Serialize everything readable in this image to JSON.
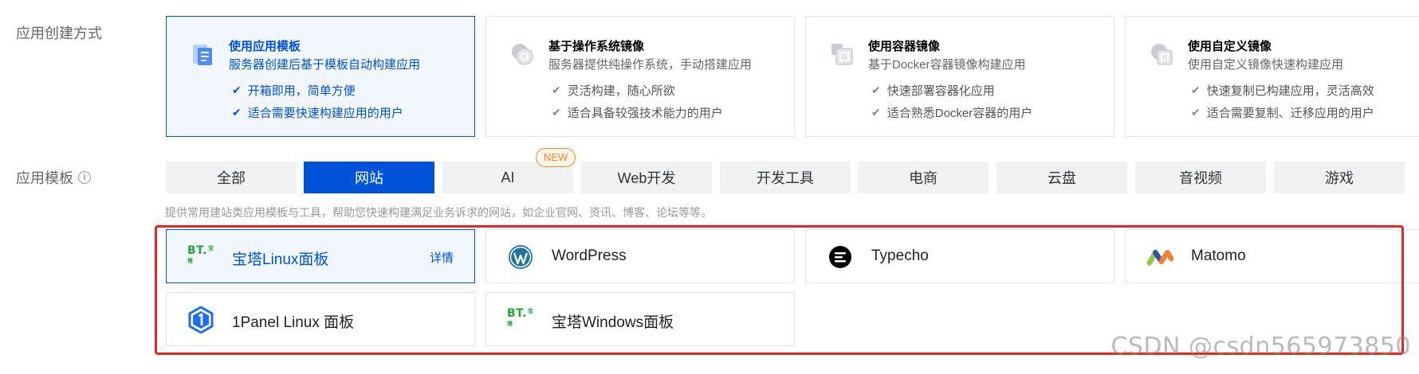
{
  "labels": {
    "create_method": "应用创建方式",
    "app_template": "应用模板"
  },
  "methods": [
    {
      "title": "使用应用模板",
      "desc": "服务器创建后基于模板自动构建应用",
      "features": [
        "开箱即用，简单方便",
        "适合需要快速构建应用的用户"
      ],
      "selected": true,
      "icon": "template-icon"
    },
    {
      "title": "基于操作系统镜像",
      "desc": "服务器提供纯操作系统，手动搭建应用",
      "features": [
        "灵活构建，随心所欲",
        "适合具备较强技术能力的用户"
      ],
      "selected": false,
      "icon": "os-image-icon"
    },
    {
      "title": "使用容器镜像",
      "desc": "基于Docker容器镜像构建应用",
      "features": [
        "快速部署容器化应用",
        "适合熟悉Docker容器的用户"
      ],
      "selected": false,
      "icon": "container-image-icon"
    },
    {
      "title": "使用自定义镜像",
      "desc": "使用自定义镜像快速构建应用",
      "features": [
        "快速复制已构建应用，灵活高效",
        "适合需要复制、迁移应用的用户"
      ],
      "selected": false,
      "icon": "custom-image-icon"
    }
  ],
  "tabs": [
    {
      "label": "全部",
      "active": false
    },
    {
      "label": "网站",
      "active": true
    },
    {
      "label": "AI",
      "active": false
    },
    {
      "label": "Web开发",
      "active": false
    },
    {
      "label": "开发工具",
      "active": false
    },
    {
      "label": "电商",
      "active": false
    },
    {
      "label": "云盘",
      "active": false
    },
    {
      "label": "音视频",
      "active": false
    },
    {
      "label": "游戏",
      "active": false
    }
  ],
  "new_badge": "NEW",
  "hint": "提供常用建站类应用模板与工具，帮助您快速构建满足业务诉求的网站，如企业官网、资讯、博客、论坛等等。",
  "apps": [
    {
      "name": "宝塔Linux面板",
      "icon": "bt-panel-icon",
      "selected": true,
      "detail": "详情"
    },
    {
      "name": "WordPress",
      "icon": "wordpress-icon",
      "selected": false
    },
    {
      "name": "Typecho",
      "icon": "typecho-icon",
      "selected": false
    },
    {
      "name": "Matomo",
      "icon": "matomo-icon",
      "selected": false
    },
    {
      "name": "1Panel Linux 面板",
      "icon": "1panel-icon",
      "selected": false
    },
    {
      "name": "宝塔Windows面板",
      "icon": "bt-panel-icon",
      "selected": false
    }
  ],
  "bt_logo_text": "BT.",
  "bt_logo_small": "宝塔",
  "watermark": "CSDN @csdn565973850",
  "colors": {
    "accent": "#0052d9",
    "annotation_red": "#e8262a",
    "new_badge": "#f28b30",
    "bt_green": "#20a53a"
  }
}
